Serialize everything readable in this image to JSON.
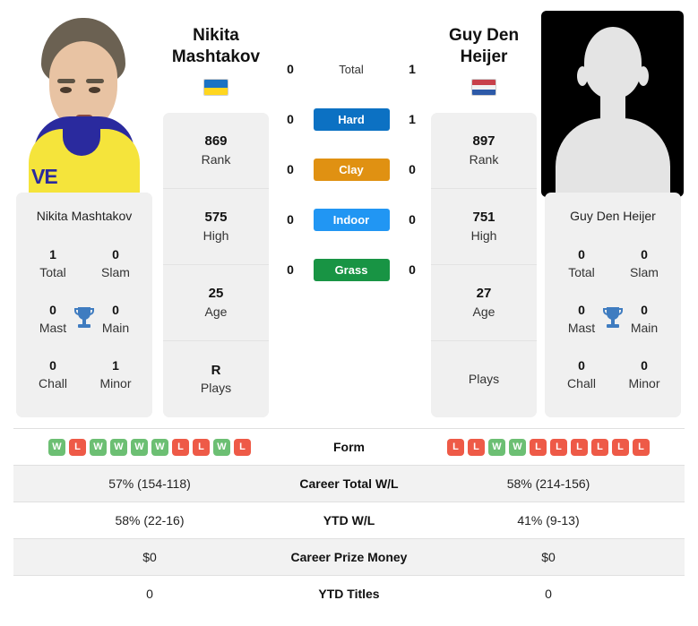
{
  "players": {
    "left": {
      "name": "Nikita Mashtakov",
      "name_lines": [
        "Nikita",
        "Mashtakov"
      ],
      "country_flag": "ukraine-flag",
      "photo": "player-photo",
      "attributes": [
        {
          "value": "869",
          "label": "Rank"
        },
        {
          "value": "575",
          "label": "High"
        },
        {
          "value": "25",
          "label": "Age"
        },
        {
          "value": "R",
          "label": "Plays"
        }
      ],
      "titles": {
        "card_name": "Nikita Mashtakov",
        "cells": [
          {
            "value": "1",
            "label": "Total"
          },
          {
            "value": "0",
            "label": "Slam"
          },
          {
            "value": "0",
            "label": "Mast"
          },
          {
            "value": "0",
            "label": "Main"
          },
          {
            "value": "0",
            "label": "Chall"
          },
          {
            "value": "1",
            "label": "Minor"
          }
        ]
      },
      "form": [
        "W",
        "L",
        "W",
        "W",
        "W",
        "W",
        "L",
        "L",
        "W",
        "L"
      ]
    },
    "right": {
      "name": "Guy Den Heijer",
      "name_lines": [
        "Guy Den",
        "Heijer"
      ],
      "country_flag": "netherlands-flag",
      "photo": "player-photo-placeholder",
      "attributes": [
        {
          "value": "897",
          "label": "Rank"
        },
        {
          "value": "751",
          "label": "High"
        },
        {
          "value": "27",
          "label": "Age"
        },
        {
          "value": "",
          "label": "Plays"
        }
      ],
      "titles": {
        "card_name": "Guy Den Heijer",
        "cells": [
          {
            "value": "0",
            "label": "Total"
          },
          {
            "value": "0",
            "label": "Slam"
          },
          {
            "value": "0",
            "label": "Mast"
          },
          {
            "value": "0",
            "label": "Main"
          },
          {
            "value": "0",
            "label": "Chall"
          },
          {
            "value": "0",
            "label": "Minor"
          }
        ]
      },
      "form": [
        "L",
        "L",
        "W",
        "W",
        "L",
        "L",
        "L",
        "L",
        "L",
        "L"
      ]
    }
  },
  "h2h": {
    "rows": [
      {
        "left": "0",
        "label": "Total",
        "right": "1",
        "style": "plain",
        "color": ""
      },
      {
        "left": "0",
        "label": "Hard",
        "right": "1",
        "style": "pill",
        "color": "#0c71c3"
      },
      {
        "left": "0",
        "label": "Clay",
        "right": "0",
        "style": "pill",
        "color": "#e09112"
      },
      {
        "left": "0",
        "label": "Indoor",
        "right": "0",
        "style": "pill",
        "color": "#2196f3"
      },
      {
        "left": "0",
        "label": "Grass",
        "right": "0",
        "style": "pill",
        "color": "#189444"
      }
    ]
  },
  "stats_table": {
    "rows": [
      {
        "type": "form",
        "label": "Form",
        "shaded": false
      },
      {
        "type": "value",
        "label": "Career Total W/L",
        "left": "57% (154-118)",
        "right": "58% (214-156)",
        "shaded": true
      },
      {
        "type": "value",
        "label": "YTD W/L",
        "left": "58% (22-16)",
        "right": "41% (9-13)",
        "shaded": false
      },
      {
        "type": "value",
        "label": "Career Prize Money",
        "left": "$0",
        "right": "$0",
        "shaded": true
      },
      {
        "type": "value",
        "label": "YTD Titles",
        "left": "0",
        "right": "0",
        "shaded": false
      }
    ]
  },
  "icons": {
    "trophy": "Ἴ6",
    "trophy_glyph": "🏆"
  },
  "colors": {
    "win": "#6cbf73",
    "loss": "#ee5a47",
    "hard": "#0c71c3",
    "clay": "#e09112",
    "indoor": "#2196f3",
    "grass": "#189444",
    "card_bg": "#f0f0f0",
    "trophy": "#3f7cc0"
  }
}
